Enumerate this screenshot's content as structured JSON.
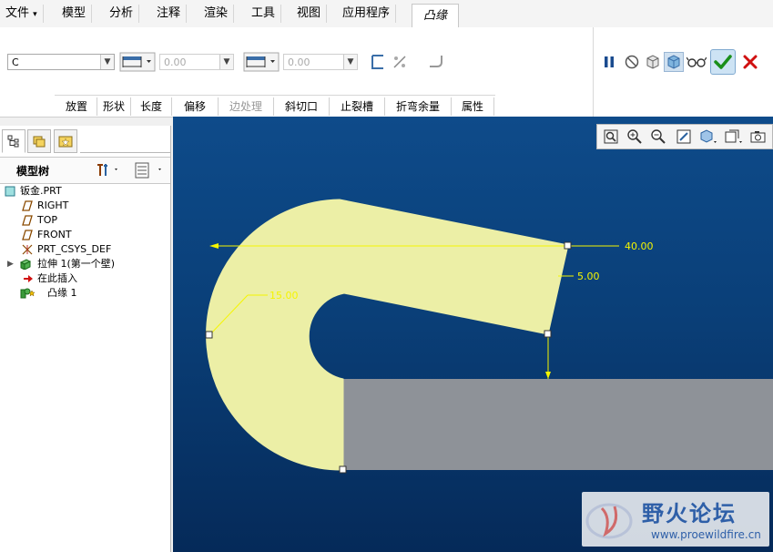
{
  "menubar": {
    "file": "文件",
    "tabs": [
      "模型",
      "分析",
      "注释",
      "渲染",
      "工具",
      "视图",
      "应用程序"
    ],
    "active_tab": "凸缘"
  },
  "ribbon": {
    "profile_value": "C",
    "length1_value": "0.00",
    "length2_value": "0.00",
    "subtabs": [
      "放置",
      "形状",
      "长度",
      "偏移",
      "边处理",
      "斜切口",
      "止裂槽",
      "折弯余量",
      "属性"
    ],
    "disabled_subtabs": [
      "边处理"
    ],
    "icons": {
      "pause": "pause-icon",
      "no_preview": "no-preview-icon",
      "preview_geometry": "preview-geometry-icon",
      "verify": "verify-mode-icon",
      "glasses": "glasses-preview-icon",
      "ok": "check-icon",
      "cancel": "close-icon"
    },
    "colors": {
      "ok": "#1a8f1a",
      "cancel": "#d01010"
    }
  },
  "sidebar": {
    "header_title": "模型树",
    "items": [
      {
        "label": "钣金.PRT",
        "icon": "part-icon"
      },
      {
        "label": "RIGHT",
        "icon": "datum-plane-icon"
      },
      {
        "label": "TOP",
        "icon": "datum-plane-icon"
      },
      {
        "label": "FRONT",
        "icon": "datum-plane-icon"
      },
      {
        "label": "PRT_CSYS_DEF",
        "icon": "csys-icon"
      },
      {
        "label": "拉伸 1(第一个壁)",
        "icon": "extrude-wall-icon"
      },
      {
        "label": "在此插入",
        "icon": "insert-here-arrow-icon"
      },
      {
        "label": "凸缘 1",
        "icon": "flange-icon"
      }
    ]
  },
  "viewport": {
    "dimensions": {
      "d1": "40.00",
      "d2": "5.00",
      "d3": "15.00"
    },
    "colors": {
      "bg_top": "#0e4b8a",
      "bg_bottom": "#052a59",
      "flange": "#ecefa6",
      "wall": "#8e9298",
      "dim": "#f5f500"
    }
  },
  "watermark": {
    "title": "野火论坛",
    "url": "www.proewildfire.cn"
  }
}
